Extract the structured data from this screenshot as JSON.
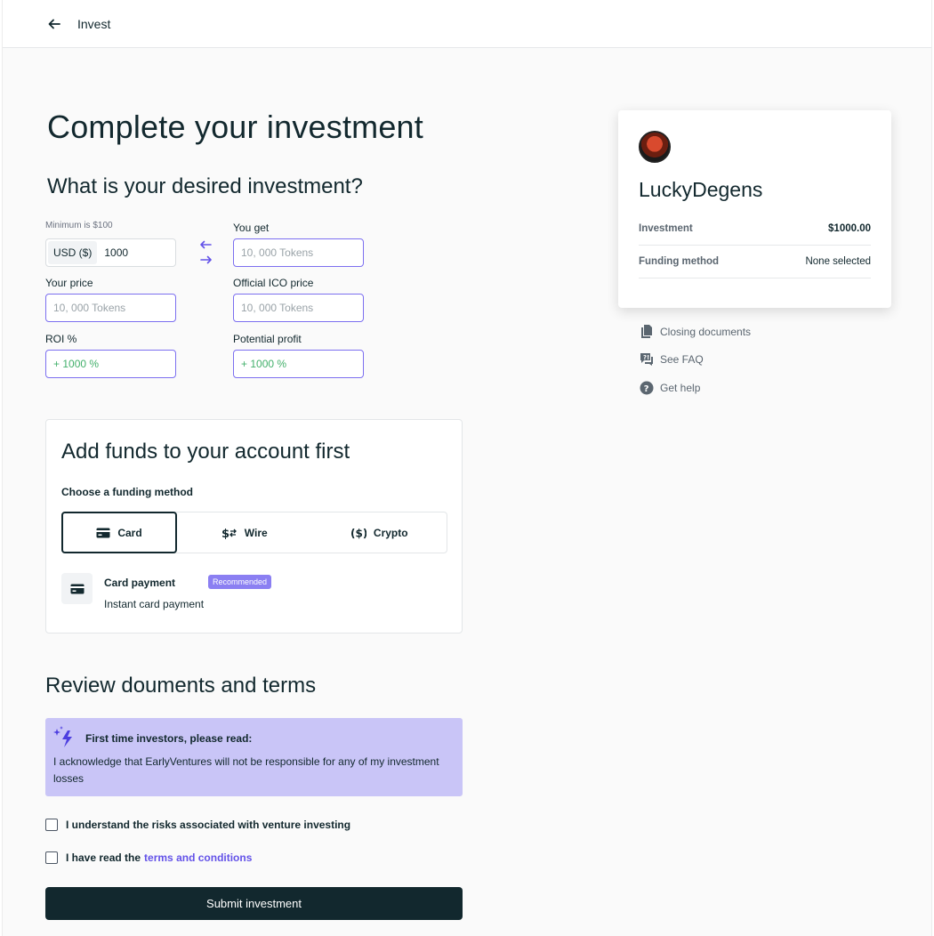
{
  "topbar": {
    "title": "Invest"
  },
  "page": {
    "title": "Complete your investment",
    "desired_heading": "What is your desired investment?"
  },
  "form": {
    "minimum_label": "Minimum is $100",
    "currency": "USD ($)",
    "amount": "1000",
    "you_get_label": "You get",
    "you_get_value": "10, 000 Tokens",
    "your_price_label": "Your price",
    "your_price_value": "10, 000 Tokens",
    "ico_price_label": "Official ICO price",
    "ico_price_value": "10, 000 Tokens",
    "roi_label": "ROI %",
    "roi_value": "+ 1000 %",
    "profit_label": "Potential profit",
    "profit_value": "+ 1000 %"
  },
  "funds": {
    "title": "Add funds to your account first",
    "subtitle": "Choose a funding method",
    "methods": [
      {
        "label": "Card",
        "icon": "credit-card-icon",
        "active": true
      },
      {
        "label": "Wire",
        "icon": "dollar-transfer-icon",
        "active": false
      },
      {
        "label": "Crypto",
        "icon": "crypto-dollar-icon",
        "active": false
      }
    ],
    "card_payment_title": "Card payment",
    "card_payment_badge": "Recommended",
    "card_payment_sub": "Instant card payment"
  },
  "review": {
    "heading": "Review douments and terms",
    "notice_title": "First time investors, please read:",
    "notice_body": "I acknowledge that EarlyVentures will not be responsible for any of my investment losses",
    "check_risks": "I understand the risks associated with venture investing",
    "check_terms_prefix": "I have read the",
    "check_terms_link": "terms and conditions",
    "submit": "Submit investment"
  },
  "summary": {
    "name": "LuckyDegens",
    "investment_label": "Investment",
    "investment_value": "$1000.00",
    "funding_label": "Funding method",
    "funding_value": "None selected"
  },
  "side_links": {
    "closing_documents": "Closing documents",
    "faq": "See FAQ",
    "help": "Get help"
  },
  "colors": {
    "primary_dark": "#12282e",
    "accent_purple": "#7c6ff0",
    "notice_bg": "#c9c5f7",
    "green": "#43b06b"
  }
}
